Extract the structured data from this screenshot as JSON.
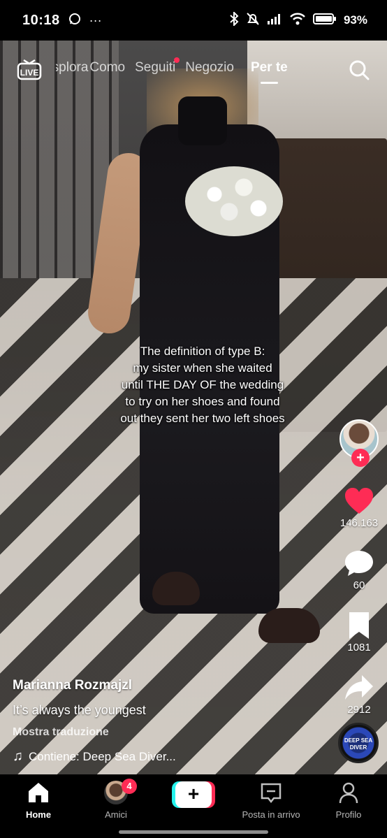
{
  "status_bar": {
    "time": "10:18",
    "more": "···",
    "battery": "93%"
  },
  "top_nav": {
    "live_label": "LIVE",
    "tabs": [
      {
        "label": "Esplora"
      },
      {
        "label": "Como"
      },
      {
        "label": "Seguiti"
      },
      {
        "label": "Negozio"
      },
      {
        "label": "Per te"
      }
    ],
    "active_tab": "Per te"
  },
  "video": {
    "overlay_text": "The definition of type B:\nmy sister when she waited\nuntil THE DAY OF the wedding\nto try on her shoes and found\nout they sent her two left shoes"
  },
  "rail": {
    "likes": "146.163",
    "comments": "60",
    "saves": "1081",
    "shares": "2912",
    "follow_symbol": "+"
  },
  "post": {
    "author": "Marianna Rozmajzl",
    "description": "It’s always the youngest",
    "translate": "Mostra traduzione",
    "sound_prefix": "♫",
    "sound": "Contiene: Deep Sea Diver...",
    "disc_text": "DEEP SEA DIVER"
  },
  "tab_bar": {
    "home": "Home",
    "friends": "Amici",
    "friends_badge": "4",
    "create_symbol": "+",
    "inbox": "Posta in arrivo",
    "profile": "Profilo"
  },
  "colors": {
    "accent_red": "#fe2c55",
    "accent_cyan": "#25f4ee"
  }
}
